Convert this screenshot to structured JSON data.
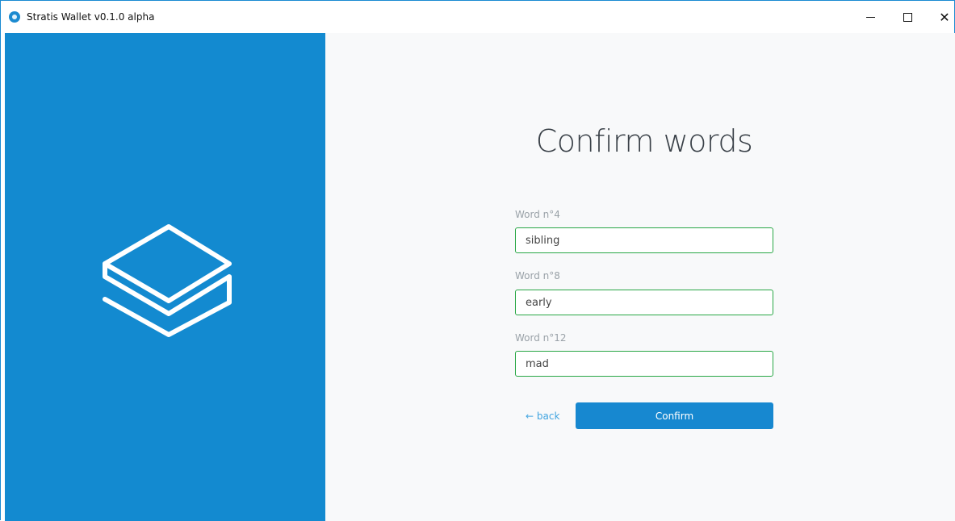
{
  "window": {
    "title": "Stratis Wallet v0.1.0 alpha",
    "icon": "stratis-icon",
    "controls": {
      "minimize": "minimize-icon",
      "maximize": "maximize-icon",
      "close_symbol": "✕"
    }
  },
  "branding": {
    "logo": "stratis-logo",
    "panel_color": "#138ad0"
  },
  "main": {
    "title": "Confirm words",
    "fields": [
      {
        "label": "Word n°4",
        "value": "sibling"
      },
      {
        "label": "Word n°8",
        "value": "early"
      },
      {
        "label": "Word n°12",
        "value": "mad"
      }
    ],
    "back_label": "← back",
    "confirm_label": "Confirm"
  },
  "colors": {
    "accent": "#1788d0",
    "valid_border": "#28a745",
    "background": "#f8f9fa"
  }
}
